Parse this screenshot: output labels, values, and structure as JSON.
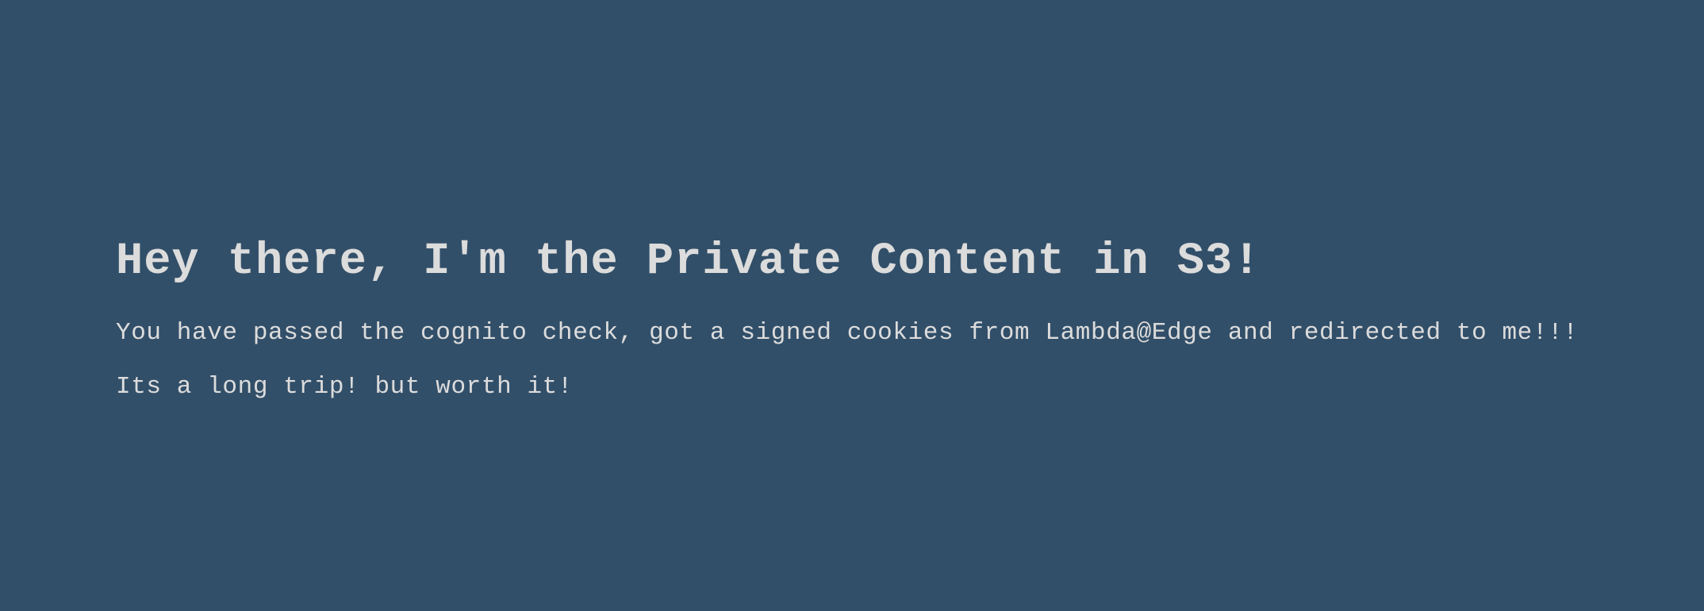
{
  "page": {
    "background_color": "#324f69",
    "text_color": "#dcdcdc",
    "heading": "Hey there, I'm the Private Content in S3!",
    "paragraphs": [
      "You have passed the cognito check, got a signed cookies from Lambda@Edge and redirected to me!!!",
      "Its a long trip! but worth it!"
    ]
  }
}
